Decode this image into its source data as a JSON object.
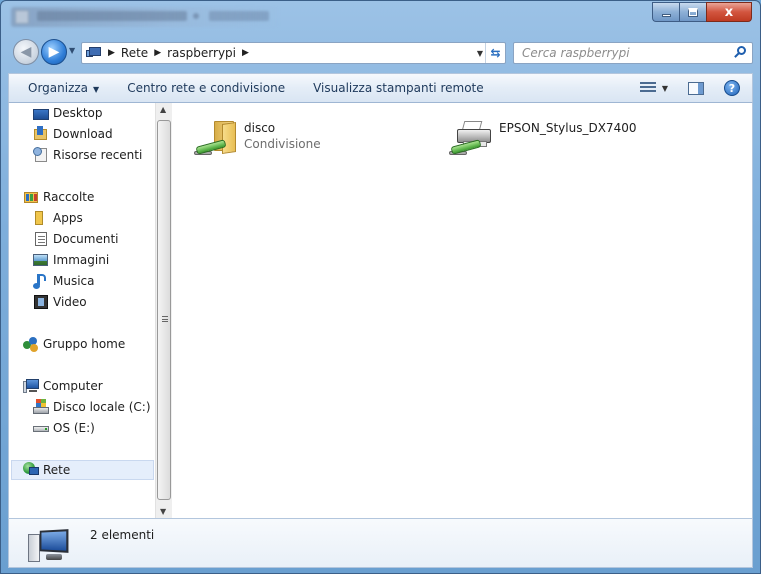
{
  "window": {
    "title_blurred": true
  },
  "caption_buttons": {
    "close_glyph": "x"
  },
  "address": {
    "crumbs": [
      "Rete",
      "raspberrypi"
    ],
    "search_placeholder": "Cerca raspberrypi"
  },
  "toolbar": {
    "organize": "Organizza",
    "network_center": "Centro rete e condivisione",
    "remote_printers": "Visualizza stampanti remote",
    "help_glyph": "?"
  },
  "nav": {
    "favorites": [
      "Desktop",
      "Download",
      "Risorse recenti"
    ],
    "libraries_header": "Raccolte",
    "libraries": [
      "Apps",
      "Documenti",
      "Immagini",
      "Musica",
      "Video"
    ],
    "homegroup": "Gruppo home",
    "computer_header": "Computer",
    "drives": [
      "Disco locale (C:)",
      "OS (E:)"
    ],
    "network": "Rete"
  },
  "items": [
    {
      "name": "disco",
      "sub": "Condivisione",
      "icon": "shared-folder-icon"
    },
    {
      "name": "EPSON_Stylus_DX7400",
      "sub": "",
      "icon": "shared-printer-icon"
    }
  ],
  "details": {
    "count_text": "2 elementi"
  },
  "colors": {
    "title_gradient": "#7eaedb",
    "selection": "#e5eefb",
    "close_red": "#d2553f"
  }
}
